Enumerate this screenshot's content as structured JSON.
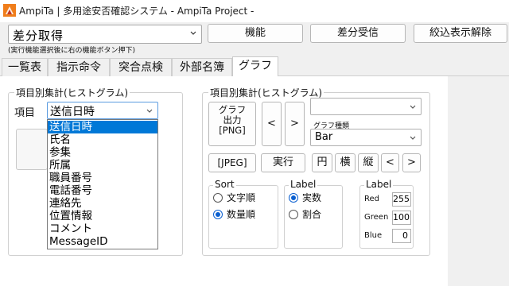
{
  "window": {
    "title": "AmpiTa | 多用途安否確認システム - AmpiTa Project -"
  },
  "toolbar": {
    "mode_value": "差分取得",
    "hint": "(実行機能選択後に右の機能ボタン押下)",
    "function_button": "機能",
    "diff_receive_button": "差分受信",
    "clear_filter_button": "絞込表示解除"
  },
  "tabs": [
    "一覧表",
    "指示命令",
    "突合点検",
    "外部名簿",
    "グラフ"
  ],
  "active_tab": "グラフ",
  "left_panel": {
    "group_title": "項目別集計(ヒストグラム)",
    "item_label": "項目",
    "item_value": "送信日時",
    "options": [
      "送信日時",
      "氏名",
      "参集",
      "所属",
      "職員番号",
      "電話番号",
      "連絡先",
      "位置情報",
      "コメント",
      "MessageID"
    ],
    "selected_index": 0
  },
  "right_panel": {
    "group_title": "項目別集計(ヒストグラム)",
    "graph_output_line1": "グラフ",
    "graph_output_line2": "出力",
    "graph_output_line3": "[PNG]",
    "prev_button": "<",
    "next_button": ">",
    "top_combo_value": "",
    "graph_type_label": "グラフ種類",
    "graph_type_value": "Bar",
    "jpeg_button": "[JPEG]",
    "run_button": "実行",
    "pie_button": "円",
    "horizontal_button": "横",
    "vertical_button": "縦",
    "scroll_left_button": "<",
    "scroll_right_button": ">",
    "sort": {
      "title": "Sort",
      "option1": "文字順",
      "option2": "数量順",
      "selected": "数量順"
    },
    "label": {
      "title": "Label",
      "option1": "実数",
      "option2": "割合",
      "selected": "実数"
    },
    "color": {
      "title": "Label",
      "red_label": "Red",
      "red_value": "255",
      "green_label": "Green",
      "green_value": "100",
      "blue_label": "Blue",
      "blue_value": "0"
    }
  },
  "colors": {
    "selection": "#0078d7",
    "radio_accent": "#0a5fd0",
    "icon_orange": "#f07d1a"
  },
  "icons": {
    "app": "ampita-logo-icon",
    "dropdown": "chevron-down-icon"
  }
}
